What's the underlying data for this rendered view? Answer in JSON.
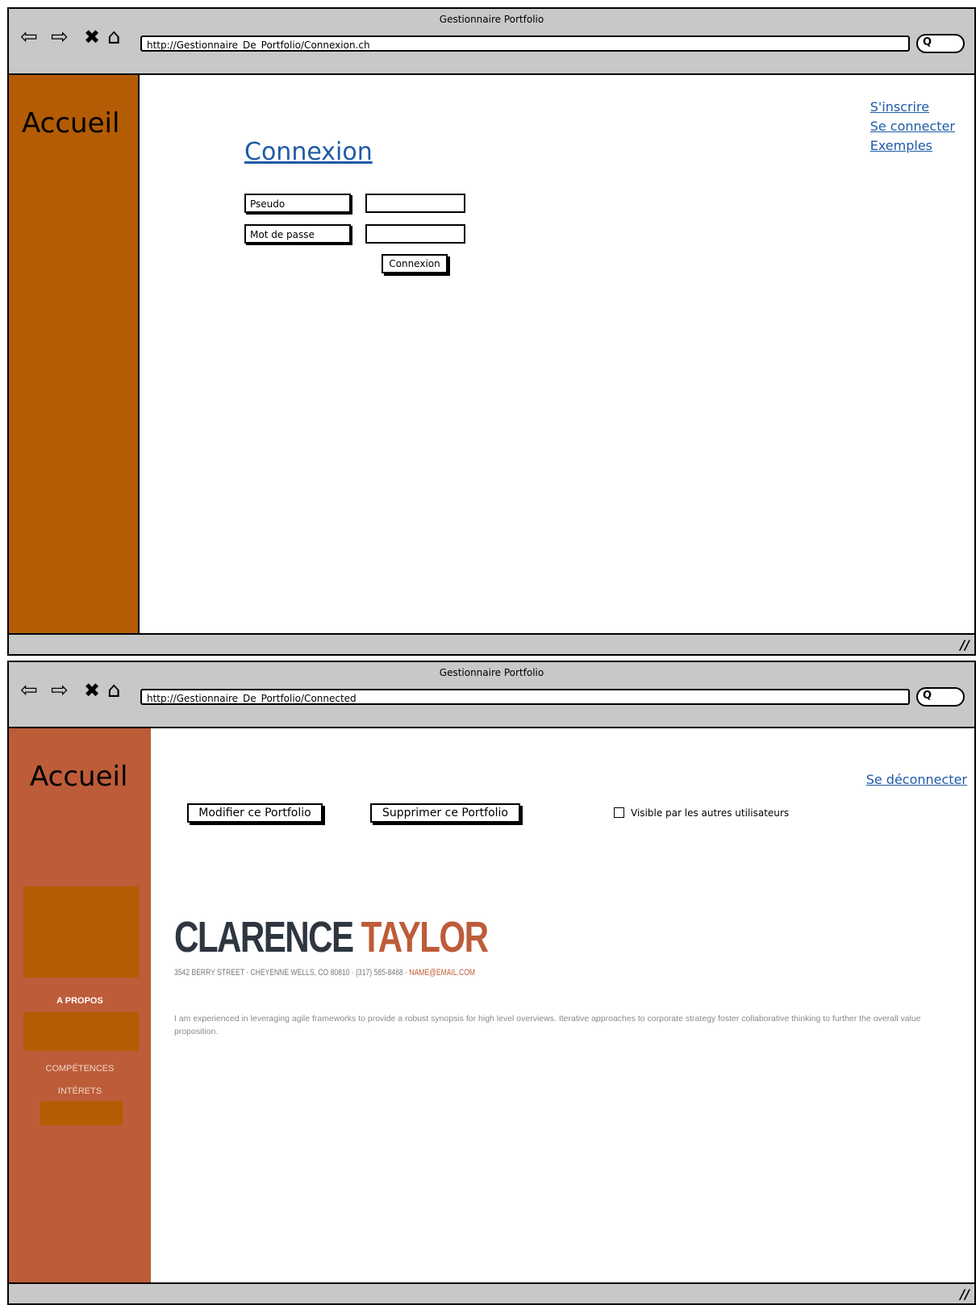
{
  "window1": {
    "title": "Gestionnaire Portfolio",
    "url": "http://Gestionnaire_De_Portfolio/Connexion.ch",
    "sidebar_title": "Accueil",
    "heading": "Connexion",
    "links": [
      "S'inscrire",
      "Se connecter",
      "Exemples"
    ],
    "form": {
      "username_label": "Pseudo",
      "password_label": "Mot de passe",
      "username_value": "",
      "password_value": "",
      "submit_label": "Connexion"
    }
  },
  "window2": {
    "title": "Gestionnaire Portfolio",
    "url": "http://Gestionnaire_De_Portfolio/Connected",
    "sidebar_title": "Accueil",
    "sidebar_items": [
      "A PROPOS",
      "COMPÉTENCES",
      "INTÉRETS"
    ],
    "logout_link": "Se déconnecter",
    "buttons": {
      "edit": "Modifier ce Portfolio",
      "delete": "Supprimer ce Portfolio"
    },
    "checkbox_label": "Visible par les autres utilisateurs",
    "resume": {
      "first_name": "CLARENCE",
      "last_name": "TAYLOR",
      "address": "3542 BERRY STREET · CHEYENNE WELLS, CO 80810 · (317) 585-8468 · ",
      "email": "NAME@EMAIL.COM",
      "description": "I am experienced in leveraging agile frameworks to provide a robust synopsis for high level overviews. Iterative approaches to corporate strategy foster collaborative thinking to further the overall value proposition."
    }
  },
  "colors": {
    "window_chrome": "#c8c8c8",
    "sidebar_orange": "#b35c04",
    "sidebar_rust": "#bd5c39",
    "link_blue": "#1f5aa6",
    "name_dark": "#2e3640"
  },
  "icons": [
    "back-arrow-icon",
    "forward-arrow-icon",
    "stop-icon",
    "home-icon",
    "search-icon",
    "resize-grip-icon"
  ]
}
